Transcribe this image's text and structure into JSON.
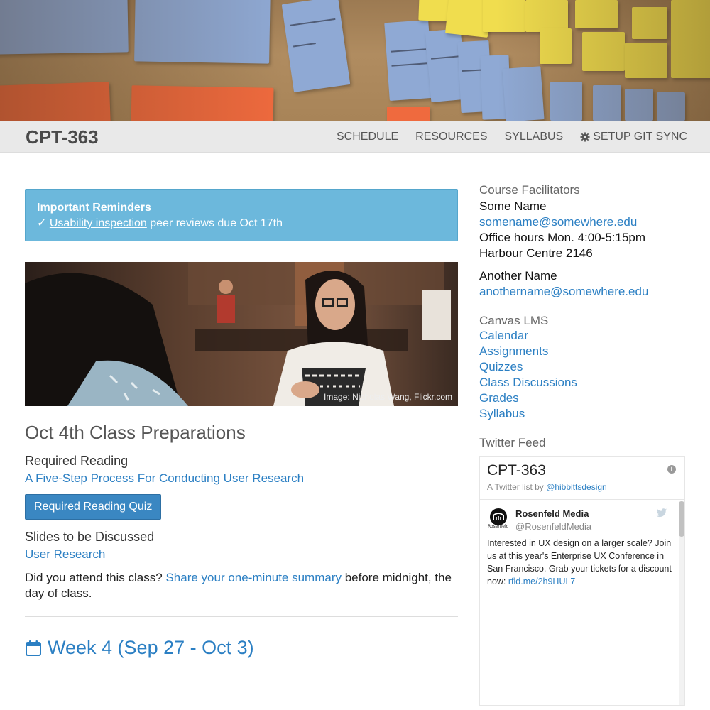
{
  "navbar": {
    "brand": "CPT-363",
    "links": [
      "SCHEDULE",
      "RESOURCES",
      "SYLLABUS"
    ],
    "git_sync": "SETUP GIT SYNC",
    "git_sync_icon": "gear-icon"
  },
  "alert": {
    "title": "Important Reminders",
    "check": "✓",
    "link": "Usability inspection",
    "rest": " peer reviews due Oct 17th"
  },
  "photo": {
    "credit": "Image: Nicholas Wang, Flickr.com"
  },
  "prep": {
    "title": "Oct 4th Class Preparations",
    "required_reading_label": "Required Reading",
    "required_reading_link": "A Five-Step Process For Conducting User Research",
    "quiz_button": "Required Reading Quiz",
    "slides_label": "Slides to be Discussed",
    "slides_link": "User Research",
    "attend_prefix": "Did you attend this class? ",
    "attend_link": "Share your one-minute summary",
    "attend_suffix": " before midnight, the day of class."
  },
  "week": {
    "icon": "calendar-icon",
    "title": "Week 4 (Sep 27 - Oct 3)"
  },
  "sidebar": {
    "facilitators_heading": "Course Facilitators",
    "facilitator1": {
      "name": "Some Name",
      "email": "somename@somewhere.edu",
      "hours": "Office hours Mon. 4:00-5:15pm",
      "room": "Harbour Centre 2146"
    },
    "facilitator2": {
      "name": "Another Name",
      "email": "anothername@somewhere.edu"
    },
    "canvas_heading": "Canvas LMS",
    "canvas_links": [
      "Calendar",
      "Assignments",
      "Quizzes",
      "Class Discussions",
      "Grades",
      "Syllabus"
    ],
    "twitter_heading": "Twitter Feed"
  },
  "twitter": {
    "title": "CPT-363",
    "sub_prefix": "A Twitter list by ",
    "sub_link": "@hibbittsdesign",
    "tweet": {
      "name": "Rosenfeld Media",
      "handle": "@RosenfeldMedia",
      "avatar_label": "Rosenfeld",
      "text": "Interested in UX design on a larger scale? Join us at this year's Enterprise UX Conference in San Francisco. Grab your tickets for a discount now: ",
      "link": "rfld.me/2h9HUL7"
    }
  },
  "colors": {
    "link": "#2b7fc3",
    "alert": "#6cb8dc",
    "button": "#3a87c2",
    "navbar": "#e9e9e9"
  }
}
